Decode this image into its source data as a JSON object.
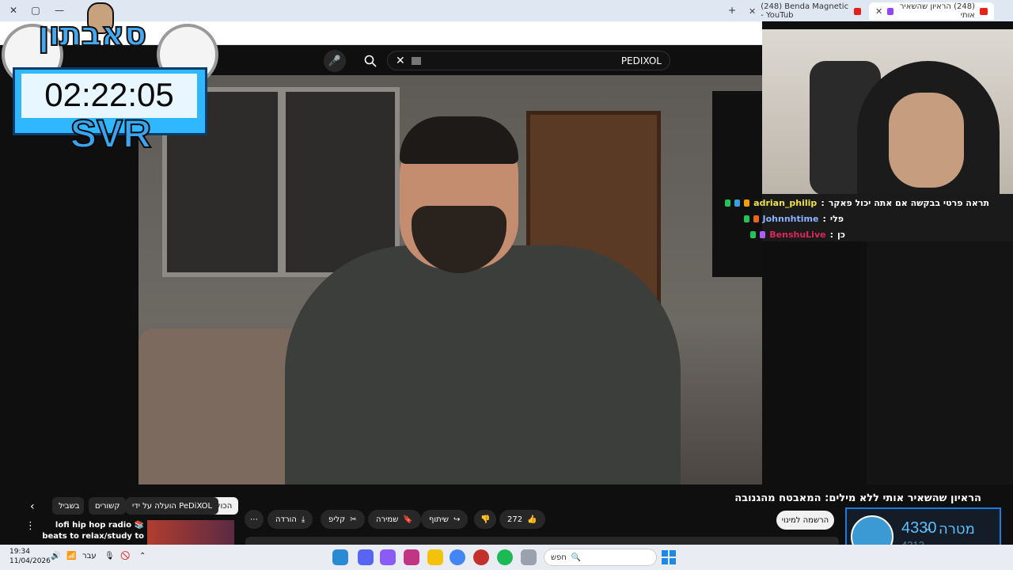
{
  "browser": {
    "tabs": [
      {
        "title": "(248) Benda Magnetic - YouTub"
      },
      {
        "title": "(248) הראיון שהשאיר אותי"
      }
    ],
    "window_controls": [
      "✕",
      "▢",
      "—"
    ]
  },
  "youtube": {
    "search_query": "PEDIXOL",
    "video_title": "הראיון שהשאיר אותי ללא מילים: המאבטח מהגנובה",
    "subscribe_label": "הרשמה למינוי",
    "actions": {
      "likes": "272",
      "share": "שיתוף",
      "save": "שמירה",
      "clip": "קליפ",
      "download": "הורדה",
      "more": "⋯"
    },
    "chips": [
      {
        "label": "הכול",
        "active": true
      },
      {
        "label": "הועלה על ידי PeDiXOL",
        "active": false
      },
      {
        "label": "קשורים",
        "active": false
      },
      {
        "label": "בשביל",
        "active": false
      }
    ],
    "recommendation": {
      "title": "lofi hip hop radio 📚 beats to relax/study to"
    }
  },
  "overlay": {
    "logo_text": "סאבתון",
    "timer": "02:22:05",
    "tag": "SVR"
  },
  "chat": [
    {
      "user": "adrian_philip",
      "message": "תראה פרטי בבקשה אם אתה יכול פאקר",
      "color": "#f0e045"
    },
    {
      "user": "Johnnhtime",
      "message": "פלי",
      "color": "#8ab4ff"
    },
    {
      "user": "BenshuLive",
      "message": "כן",
      "color": "#e0245e"
    }
  ],
  "goal": {
    "label": "מטרה",
    "current": "4330",
    "target": "4313",
    "separator": "–"
  },
  "taskbar": {
    "time": "19:34",
    "date": "11/04/2026",
    "search_placeholder": "חפש",
    "language": "עבר"
  }
}
